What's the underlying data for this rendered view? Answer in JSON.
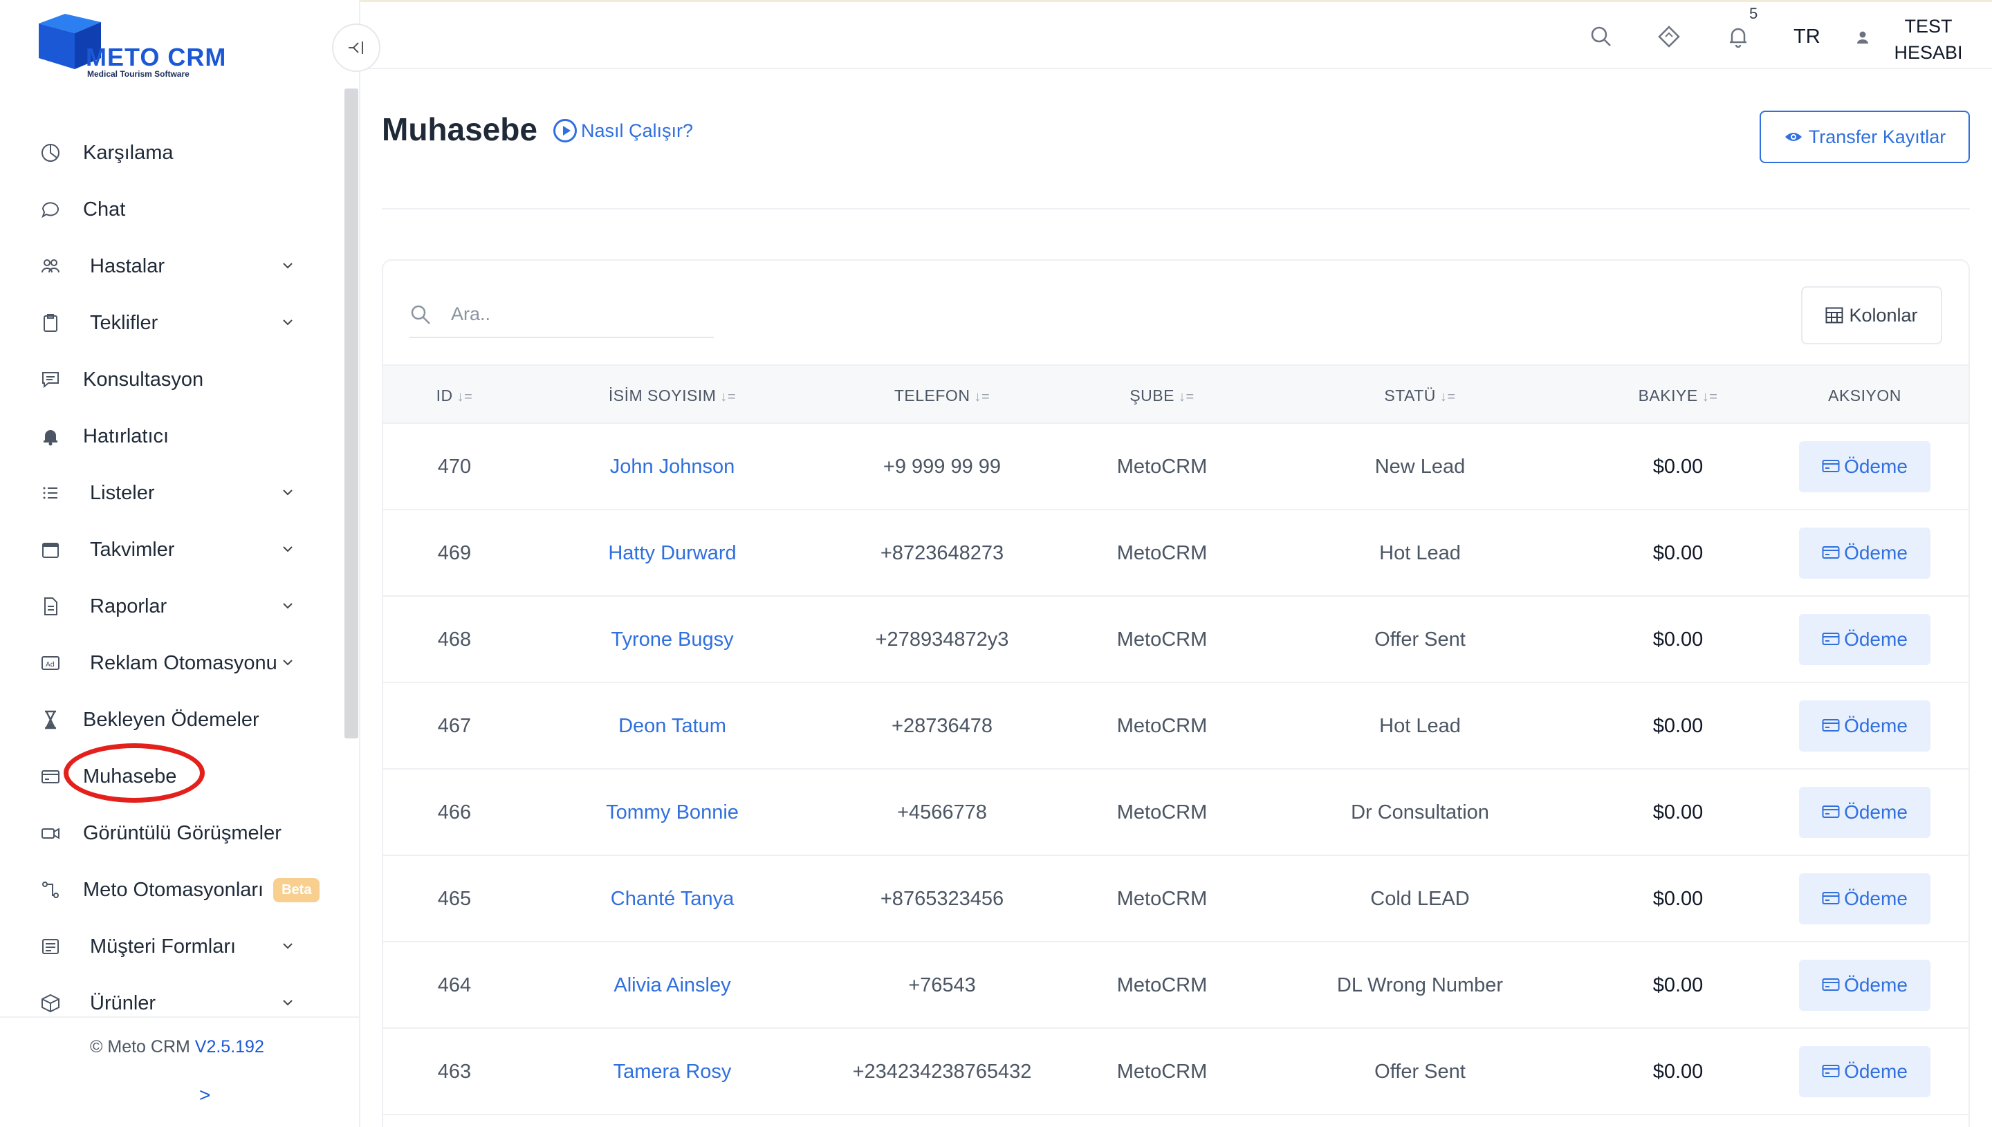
{
  "brand": {
    "name": "METO CRM",
    "tagline": "Medical Tourism Software"
  },
  "sidebar": {
    "items": [
      {
        "label": "Karşılama",
        "icon": "dashboard-icon",
        "submenu": false
      },
      {
        "label": "Chat",
        "icon": "chat-icon",
        "submenu": false
      },
      {
        "label": "Hastalar",
        "icon": "users-icon",
        "submenu": true
      },
      {
        "label": "Teklifler",
        "icon": "clipboard-icon",
        "submenu": true
      },
      {
        "label": "Konsultasyon",
        "icon": "message-icon",
        "submenu": false
      },
      {
        "label": "Hatırlatıcı",
        "icon": "bell-icon",
        "submenu": false
      },
      {
        "label": "Listeler",
        "icon": "list-icon",
        "submenu": true
      },
      {
        "label": "Takvimler",
        "icon": "calendar-icon",
        "submenu": true
      },
      {
        "label": "Raporlar",
        "icon": "report-icon",
        "submenu": true
      },
      {
        "label": "Reklam Otomasyonu",
        "icon": "ad-icon",
        "submenu": true
      },
      {
        "label": "Bekleyen Ödemeler",
        "icon": "hourglass-icon",
        "submenu": false
      },
      {
        "label": "Muhasebe",
        "icon": "credit-card-icon",
        "submenu": false,
        "highlighted": true
      },
      {
        "label": "Görüntülü Görüşmeler",
        "icon": "video-icon",
        "submenu": false
      },
      {
        "label": "Meto Otomasyonları",
        "icon": "automation-icon",
        "submenu": false,
        "badge": "Beta"
      },
      {
        "label": "Müşteri Formları",
        "icon": "form-icon",
        "submenu": true
      },
      {
        "label": "Ürünler",
        "icon": "box-icon",
        "submenu": true
      }
    ],
    "footer": {
      "copyright": "© Meto CRM",
      "version": "V2.5.192",
      "more": ">"
    }
  },
  "topbar": {
    "notification_count": "5",
    "language": "TR",
    "user_line1": "TEST",
    "user_line2": "HESABI"
  },
  "page": {
    "title": "Muhasebe",
    "howto_label": "Nasıl Çalışır?",
    "transfer_label": "Transfer Kayıtlar"
  },
  "table": {
    "search_placeholder": "Ara..",
    "columns_button": "Kolonlar",
    "headers": [
      "ID",
      "İSİM SOYISIM",
      "TELEFON",
      "ŞUBE",
      "STATÜ",
      "BAKIYE",
      "AKSIYON"
    ],
    "action_label": "Ödeme",
    "rows": [
      {
        "id": "470",
        "name": "John Johnson",
        "phone": "+9 999 99 99",
        "branch": "MetoCRM",
        "status": "New Lead",
        "balance": "$0.00"
      },
      {
        "id": "469",
        "name": "Hatty Durward",
        "phone": "+8723648273",
        "branch": "MetoCRM",
        "status": "Hot Lead",
        "balance": "$0.00"
      },
      {
        "id": "468",
        "name": "Tyrone Bugsy",
        "phone": "+278934872y3",
        "branch": "MetoCRM",
        "status": "Offer Sent",
        "balance": "$0.00"
      },
      {
        "id": "467",
        "name": "Deon Tatum",
        "phone": "+28736478",
        "branch": "MetoCRM",
        "status": "Hot Lead",
        "balance": "$0.00"
      },
      {
        "id": "466",
        "name": "Tommy Bonnie",
        "phone": "+4566778",
        "branch": "MetoCRM",
        "status": "Dr Consultation",
        "balance": "$0.00"
      },
      {
        "id": "465",
        "name": "Chanté Tanya",
        "phone": "+8765323456",
        "branch": "MetoCRM",
        "status": "Cold LEAD",
        "balance": "$0.00"
      },
      {
        "id": "464",
        "name": "Alivia Ainsley",
        "phone": "+76543",
        "branch": "MetoCRM",
        "status": "DL Wrong Number",
        "balance": "$0.00"
      },
      {
        "id": "463",
        "name": "Tamera Rosy",
        "phone": "+234234238765432",
        "branch": "MetoCRM",
        "status": "Offer Sent",
        "balance": "$0.00"
      }
    ]
  },
  "colors": {
    "accent": "#2f6fde",
    "brand": "#1b58d6",
    "highlight_circle": "#e3201b",
    "beta_badge": "#f8cf8f"
  }
}
